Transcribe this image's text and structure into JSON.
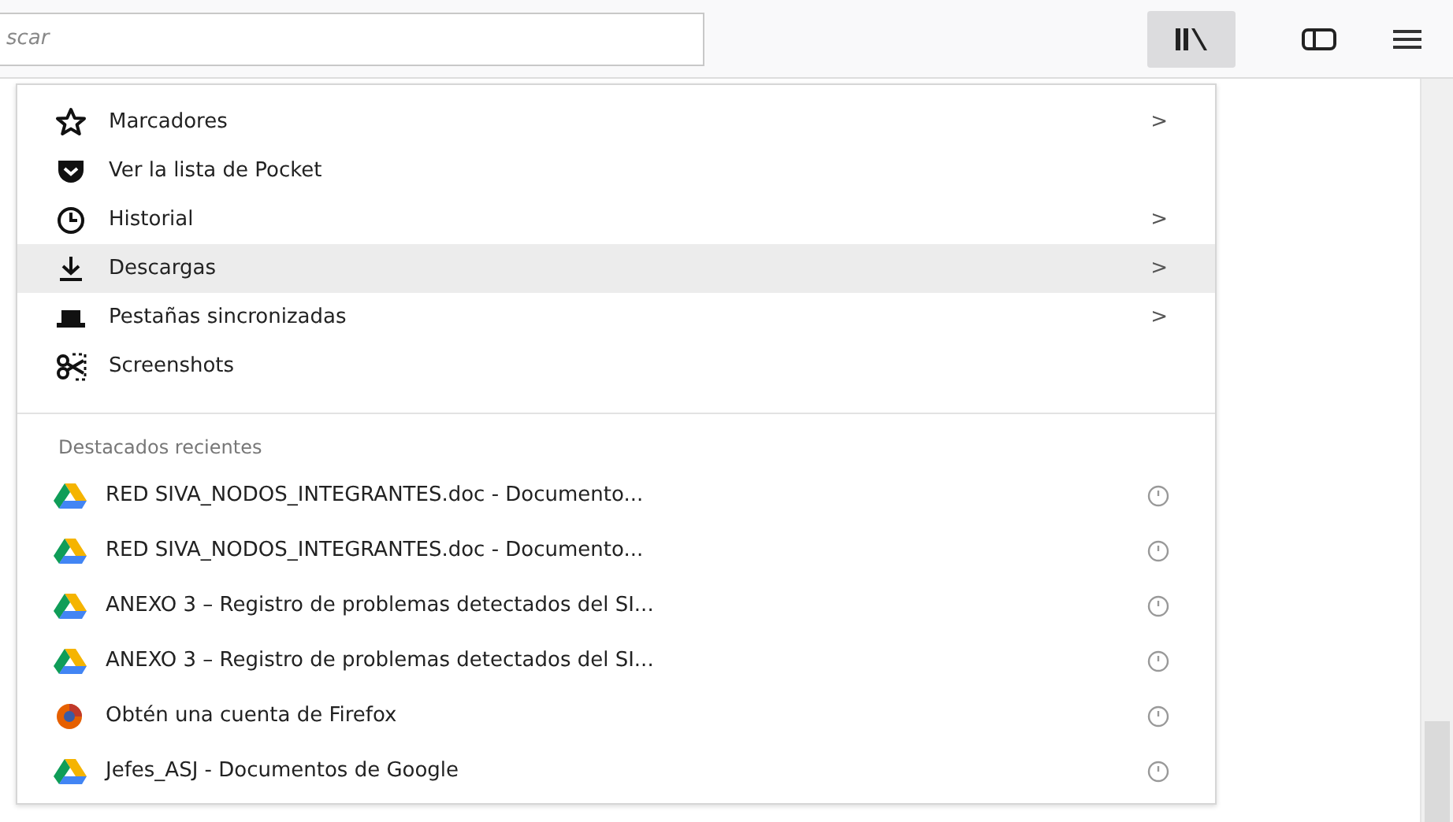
{
  "toolbar": {
    "search": {
      "placeholder": "scar"
    },
    "buttons": [
      {
        "kind": "library",
        "selected": true
      },
      {
        "kind": "sidebar",
        "selected": false
      },
      {
        "kind": "menu",
        "selected": false
      }
    ]
  },
  "library_menu": {
    "items": [
      {
        "label": "Marcadores",
        "submenu": true,
        "selected": false
      },
      {
        "label": "Ver la lista de Pocket",
        "submenu": false,
        "selected": false
      },
      {
        "label": "Historial",
        "submenu": true,
        "selected": false
      },
      {
        "label": "Descargas",
        "submenu": true,
        "selected": true
      },
      {
        "label": "Pestañas sincronizadas",
        "submenu": true,
        "selected": false
      },
      {
        "label": "Screenshots",
        "submenu": false,
        "selected": false
      }
    ],
    "submenu_arrow": ">",
    "recent_header": "Destacados recientes",
    "recent": [
      {
        "kind": "drive",
        "label": "RED SIVA_NODOS_INTEGRANTES.doc - Documento..."
      },
      {
        "kind": "drive",
        "label": "RED SIVA_NODOS_INTEGRANTES.doc - Documento..."
      },
      {
        "kind": "drive",
        "label": "ANEXO 3 – Registro de problemas detectados del SI..."
      },
      {
        "kind": "drive",
        "label": "ANEXO 3 – Registro de problemas detectados del SI..."
      },
      {
        "kind": "firefox",
        "label": "Obtén una cuenta de Firefox"
      },
      {
        "kind": "drive",
        "label": "Jefes_ASJ - Documentos de Google"
      }
    ]
  }
}
